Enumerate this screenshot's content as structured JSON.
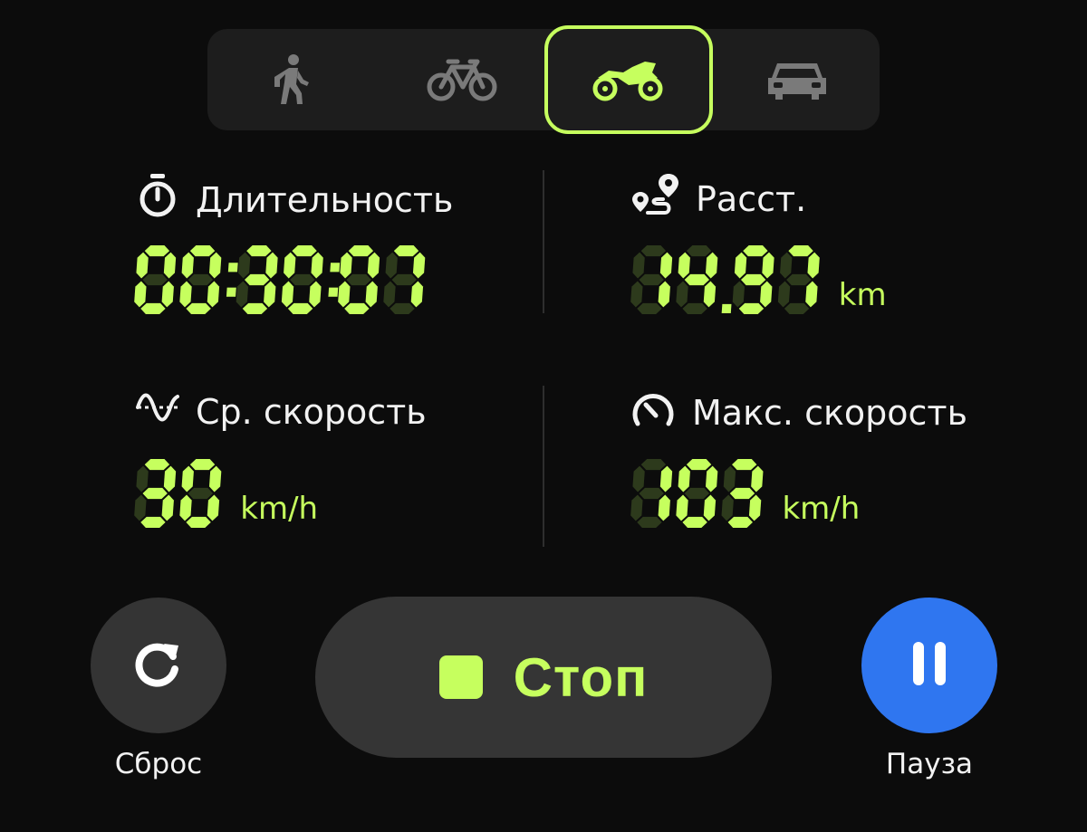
{
  "colors": {
    "accent": "#c6ff5e",
    "segment_off": "#2d3a1c",
    "pause_blue": "#2f76f0",
    "icon_inactive": "#7a7a7a"
  },
  "modes": [
    {
      "icon": "walk-icon",
      "active": false
    },
    {
      "icon": "bicycle-icon",
      "active": false
    },
    {
      "icon": "motorcycle-icon",
      "active": true
    },
    {
      "icon": "car-icon",
      "active": false
    }
  ],
  "stats": {
    "duration": {
      "icon": "stopwatch-icon",
      "label": "Длительность",
      "value": "00:30:07"
    },
    "distance": {
      "icon": "route-icon",
      "label": "Расст.",
      "value": "14.97",
      "unit": "km"
    },
    "avg_speed": {
      "icon": "avg-speed-icon",
      "label": "Ср. скорость",
      "value": "30",
      "unit": "km/h"
    },
    "max_speed": {
      "icon": "speedometer-icon",
      "label": "Макс. скорость",
      "value": "103",
      "unit": "km/h"
    }
  },
  "controls": {
    "reset": {
      "icon": "refresh-icon",
      "label": "Сброс"
    },
    "stop": {
      "icon": "stop-square-icon",
      "label": "Стоп"
    },
    "pause": {
      "icon": "pause-icon",
      "label": "Пауза"
    }
  }
}
